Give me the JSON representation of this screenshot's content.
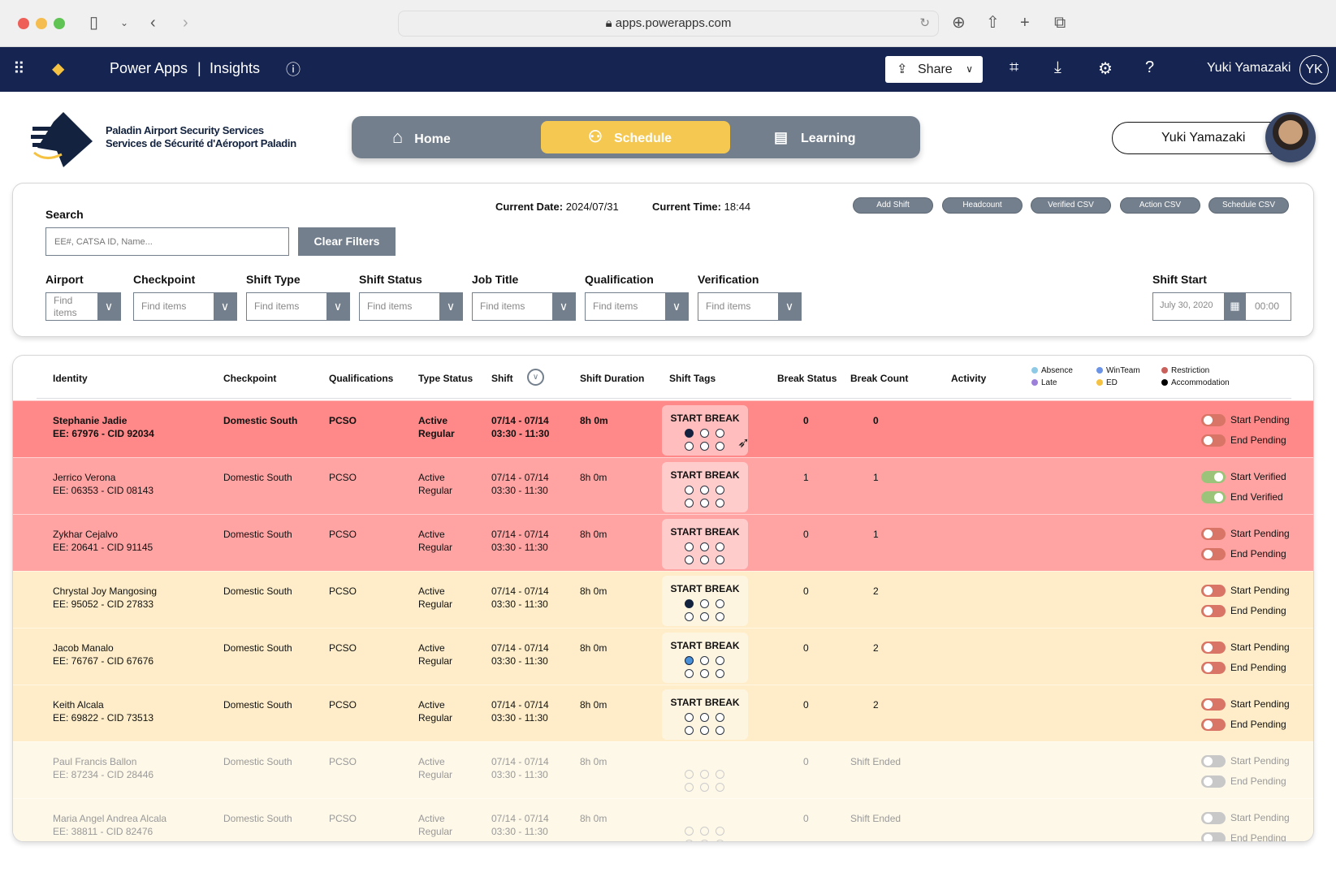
{
  "browser": {
    "url": "apps.powerapps.com"
  },
  "appbar": {
    "product": "Power Apps",
    "separator": "|",
    "app": "Insights",
    "share": "Share",
    "user": "Yuki Yamazaki",
    "initials": "YK"
  },
  "brand": {
    "line1": "Paladin Airport Security Services",
    "line2": "Services de Sécurité d'Aéroport Paladin"
  },
  "tabs": [
    {
      "label": "Home",
      "icon": "home-icon",
      "active": false
    },
    {
      "label": "Schedule",
      "icon": "people-icon",
      "active": true
    },
    {
      "label": "Learning",
      "icon": "newspaper-icon",
      "active": false
    }
  ],
  "user_pill": {
    "name": "Yuki Yamazaki"
  },
  "filters": {
    "search_label": "Search",
    "search_placeholder": "EE#, CATSA ID, Name...",
    "clear": "Clear Filters",
    "current_date_label": "Current Date:",
    "current_date": "2024/07/31",
    "current_time_label": "Current Time:",
    "current_time": "18:44",
    "actions": [
      "Add Shift",
      "Headcount",
      "Verified CSV",
      "Action CSV",
      "Schedule CSV"
    ],
    "dropdowns": [
      {
        "label": "Airport",
        "placeholder": "Find items"
      },
      {
        "label": "Checkpoint",
        "placeholder": "Find items"
      },
      {
        "label": "Shift Type",
        "placeholder": "Find items"
      },
      {
        "label": "Shift Status",
        "placeholder": "Find items"
      },
      {
        "label": "Job Title",
        "placeholder": "Find items"
      },
      {
        "label": "Qualification",
        "placeholder": "Find items"
      },
      {
        "label": "Verification",
        "placeholder": "Find items"
      }
    ],
    "shift_start_label": "Shift Start",
    "shift_start_date": "July 30, 2020",
    "shift_start_time": "00:00"
  },
  "table": {
    "headers": [
      "Identity",
      "Checkpoint",
      "Qualifications",
      "Type Status",
      "Shift",
      "Shift Duration",
      "Shift Tags",
      "Break Status",
      "Break Count",
      "Activity"
    ],
    "legend": [
      {
        "label": "Absence",
        "color": "#8ecae6"
      },
      {
        "label": "Late",
        "color": "#9b7fd8"
      },
      {
        "label": "WinTeam",
        "color": "#6b93e6"
      },
      {
        "label": "ED",
        "color": "#f5c242"
      },
      {
        "label": "Restriction",
        "color": "#c9605c"
      },
      {
        "label": "Accommodation",
        "color": "#000000"
      }
    ],
    "colors": {
      "critical": "#ff8888",
      "alert": "#ffa3a3",
      "warning": "#feedc8",
      "ended": "#fef8e8",
      "toggle_pending": "#d97566",
      "toggle_verified": "#9bc47a",
      "toggle_disabled": "#c8c8c8",
      "dot_dark": "#13233f",
      "dot_blue": "#4a90d9"
    },
    "rows": [
      {
        "name": "Stephanie Jadie",
        "ids": "EE: 67976 - CID 92034",
        "checkpoint": "Domestic South",
        "qual": "PCSO",
        "type1": "Active",
        "type2": "Regular",
        "shift1": "07/14 - 07/14",
        "shift2": "03:30 - 11:30",
        "duration": "8h 0m",
        "tag": "START BREAK",
        "dots": [
          "dark",
          "",
          "",
          "",
          "",
          ""
        ],
        "break_status": "0",
        "break_count": "0",
        "start": "Start Pending",
        "end": "End Pending",
        "state": "critical",
        "toggle": "pending",
        "bold": true
      },
      {
        "name": "Jerrico Verona",
        "ids": "EE: 06353 - CID 08143",
        "checkpoint": "Domestic South",
        "qual": "PCSO",
        "type1": "Active",
        "type2": "Regular",
        "shift1": "07/14 - 07/14",
        "shift2": "03:30 - 11:30",
        "duration": "8h 0m",
        "tag": "START BREAK",
        "dots": [
          "",
          "",
          "",
          "",
          "",
          ""
        ],
        "break_status": "1",
        "break_count": "1",
        "start": "Start Verified",
        "end": "End Verified",
        "state": "alert",
        "toggle": "verified"
      },
      {
        "name": "Zykhar Cejalvo",
        "ids": "EE: 20641 - CID 91145",
        "checkpoint": "Domestic South",
        "qual": "PCSO",
        "type1": "Active",
        "type2": "Regular",
        "shift1": "07/14 - 07/14",
        "shift2": "03:30 - 11:30",
        "duration": "8h 0m",
        "tag": "START BREAK",
        "dots": [
          "",
          "",
          "",
          "",
          "",
          ""
        ],
        "break_status": "0",
        "break_count": "1",
        "start": "Start Pending",
        "end": "End Pending",
        "state": "alert",
        "toggle": "pending"
      },
      {
        "name": "Chrystal Joy Mangosing",
        "ids": "EE: 95052 - CID 27833",
        "checkpoint": "Domestic South",
        "qual": "PCSO",
        "type1": "Active",
        "type2": "Regular",
        "shift1": "07/14 - 07/14",
        "shift2": "03:30 - 11:30",
        "duration": "8h 0m",
        "tag": "START BREAK",
        "dots": [
          "dark",
          "",
          "",
          "",
          "",
          ""
        ],
        "break_status": "0",
        "break_count": "2",
        "start": "Start Pending",
        "end": "End Pending",
        "state": "warning",
        "toggle": "pending"
      },
      {
        "name": "Jacob Manalo",
        "ids": "EE: 76767 - CID 67676",
        "checkpoint": "Domestic South",
        "qual": "PCSO",
        "type1": "Active",
        "type2": "Regular",
        "shift1": "07/14 - 07/14",
        "shift2": "03:30 - 11:30",
        "duration": "8h 0m",
        "tag": "START BREAK",
        "dots": [
          "blue",
          "",
          "",
          "",
          "",
          ""
        ],
        "break_status": "0",
        "break_count": "2",
        "start": "Start Pending",
        "end": "End Pending",
        "state": "warning",
        "toggle": "pending"
      },
      {
        "name": "Keith Alcala",
        "ids": "EE: 69822 - CID 73513",
        "checkpoint": "Domestic South",
        "qual": "PCSO",
        "type1": "Active",
        "type2": "Regular",
        "shift1": "07/14 - 07/14",
        "shift2": "03:30 - 11:30",
        "duration": "8h 0m",
        "tag": "START BREAK",
        "dots": [
          "",
          "",
          "",
          "",
          "",
          ""
        ],
        "break_status": "0",
        "break_count": "2",
        "start": "Start Pending",
        "end": "End Pending",
        "state": "warning",
        "toggle": "pending"
      },
      {
        "name": "Paul Francis Ballon",
        "ids": "EE: 87234 - CID 28446",
        "checkpoint": "Domestic South",
        "qual": "PCSO",
        "type1": "Active",
        "type2": "Regular",
        "shift1": "07/14 - 07/14",
        "shift2": "03:30 - 11:30",
        "duration": "8h 0m",
        "tag": "",
        "dots": [
          "",
          "",
          "",
          "",
          "",
          ""
        ],
        "break_status": "0",
        "break_count": "Shift Ended",
        "start": "Start Pending",
        "end": "End Pending",
        "state": "ended",
        "toggle": "disabled"
      },
      {
        "name": "Maria Angel Andrea Alcala",
        "ids": "EE: 38811 - CID 82476",
        "checkpoint": "Domestic South",
        "qual": "PCSO",
        "type1": "Active",
        "type2": "Regular",
        "shift1": "07/14 - 07/14",
        "shift2": "03:30 - 11:30",
        "duration": "8h 0m",
        "tag": "",
        "dots": [
          "",
          "",
          "",
          "",
          "",
          ""
        ],
        "break_status": "0",
        "break_count": "Shift Ended",
        "start": "Start Pending",
        "end": "End Pending",
        "state": "ended",
        "toggle": "disabled"
      }
    ]
  }
}
